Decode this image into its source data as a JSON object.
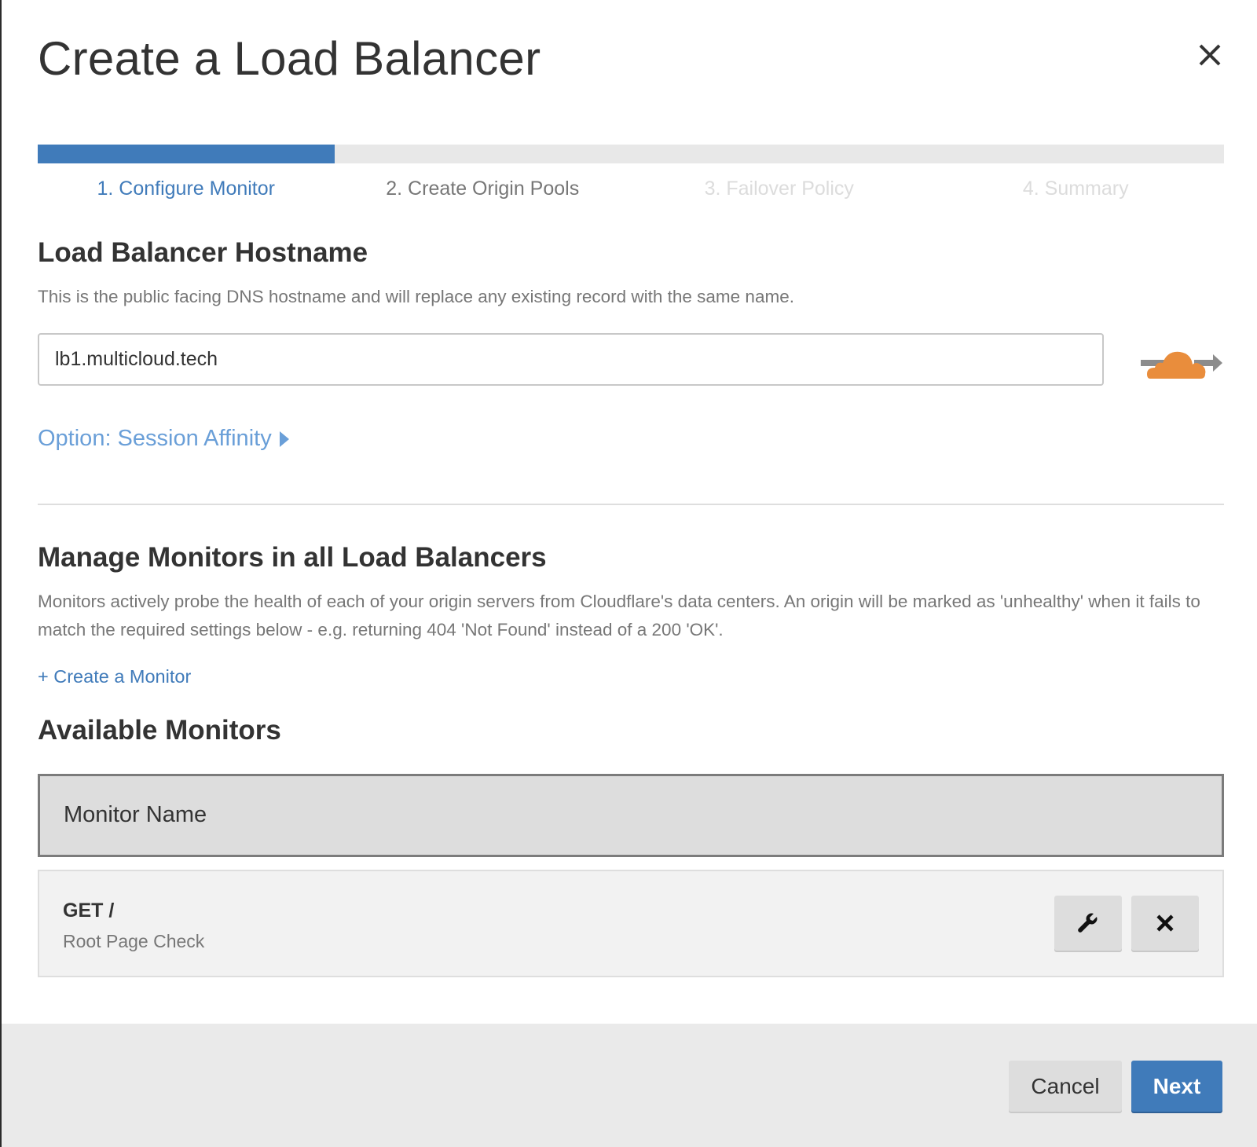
{
  "dialog": {
    "title": "Create a Load Balancer",
    "close_icon": "close-icon"
  },
  "wizard": {
    "progress_percent": 25,
    "current_step": 1,
    "total_steps": 4,
    "steps": [
      {
        "label": "1. Configure Monitor",
        "state": "active"
      },
      {
        "label": "2. Create Origin Pools",
        "state": "next"
      },
      {
        "label": "3. Failover Policy",
        "state": "disabled"
      },
      {
        "label": "4. Summary",
        "state": "disabled"
      }
    ]
  },
  "hostname": {
    "heading": "Load Balancer Hostname",
    "description": "This is the public facing DNS hostname and will replace any existing record with the same name.",
    "value": "lb1.multicloud.tech",
    "proxy_icon": "cloudflare-proxied-cloud-icon",
    "session_affinity_label": "Option: Session Affinity",
    "session_affinity_icon": "caret-right-icon"
  },
  "monitors": {
    "heading": "Manage Monitors in all Load Balancers",
    "description": "Monitors actively probe the health of each of your origin servers from Cloudflare's data centers. An origin will be marked as 'unhealthy' when it fails to match the required settings below - e.g. returning 404 'Not Found' instead of a 200 'OK'.",
    "create_link": "+ Create a Monitor",
    "available_heading": "Available Monitors",
    "table": {
      "columns": [
        "Monitor Name"
      ],
      "rows": [
        {
          "title": "GET /",
          "subtitle": "Root Page Check",
          "actions": [
            "edit-wrench-icon",
            "delete-close-icon"
          ]
        }
      ]
    }
  },
  "footer": {
    "cancel_label": "Cancel",
    "next_label": "Next"
  },
  "colors": {
    "accent": "#407bba",
    "link_light": "#6a9fd8",
    "cloud_orange": "#e98d3c",
    "cloud_arrow_gray": "#8c8c8c"
  }
}
